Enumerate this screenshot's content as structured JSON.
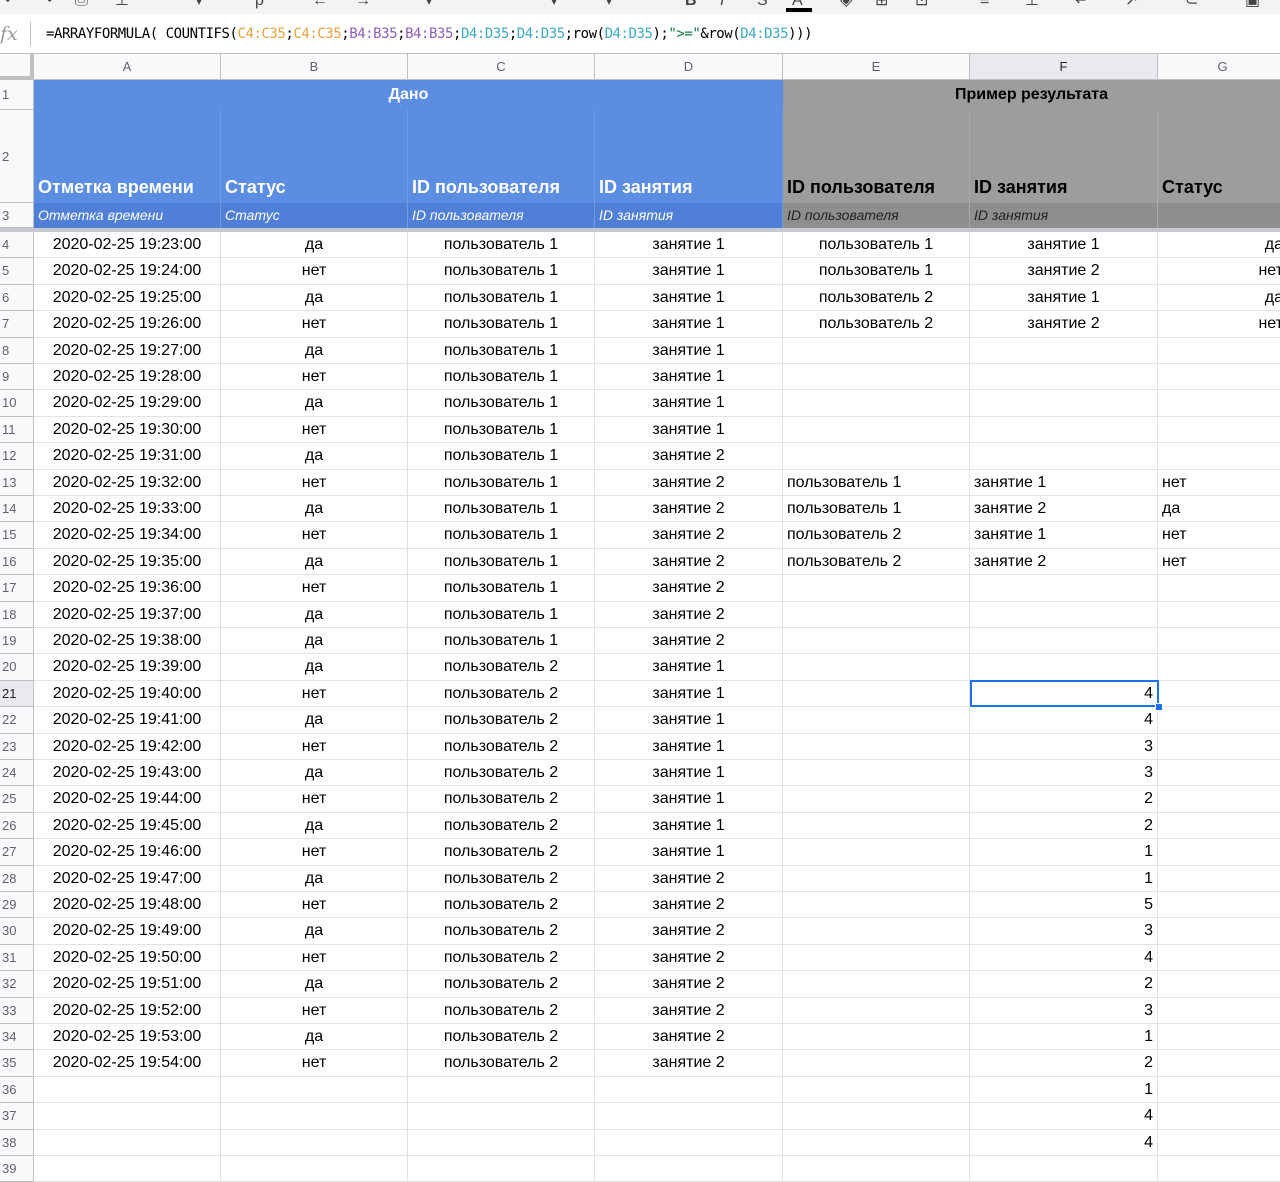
{
  "toolbar": {
    "icons": [
      "undo-icon",
      "redo-icon",
      "print-icon",
      "paint-format-icon",
      "zoom-select",
      "currency-icon",
      "decrease-decimal-icon",
      "increase-decimal-icon",
      "more-formats-icon",
      "font-select",
      "font-size-select",
      "bold-icon",
      "italic-icon",
      "strikethrough-icon",
      "text-color-icon",
      "fill-color-icon",
      "borders-icon",
      "merge-icon",
      "align-icon",
      "valign-icon",
      "wrap-icon",
      "rotate-icon",
      "link-icon",
      "comment-icon"
    ]
  },
  "formula_bar": {
    "fx": "fx",
    "segments": [
      {
        "text": "=ARRAYFORMULA( COUNTIFS(",
        "color": "#000000"
      },
      {
        "text": "C4:C35",
        "color": "#e8a23c"
      },
      {
        "text": ";",
        "color": "#000000"
      },
      {
        "text": "C4:C35",
        "color": "#e8a23c"
      },
      {
        "text": ";",
        "color": "#000000"
      },
      {
        "text": "B4:B35",
        "color": "#8e5fb5"
      },
      {
        "text": ";",
        "color": "#000000"
      },
      {
        "text": "B4:B35",
        "color": "#8e5fb5"
      },
      {
        "text": ";",
        "color": "#000000"
      },
      {
        "text": "D4:D35",
        "color": "#3fa9c0"
      },
      {
        "text": ";",
        "color": "#000000"
      },
      {
        "text": "D4:D35",
        "color": "#3fa9c0"
      },
      {
        "text": ";row(",
        "color": "#000000"
      },
      {
        "text": "D4:D35",
        "color": "#3fa9c0"
      },
      {
        "text": ");",
        "color": "#000000"
      },
      {
        "text": "\">=\"",
        "color": "#0b8043"
      },
      {
        "text": "&row(",
        "color": "#000000"
      },
      {
        "text": "D4:D35",
        "color": "#3fa9c0"
      },
      {
        "text": ")))",
        "color": "#000000"
      }
    ]
  },
  "columns": [
    "A",
    "B",
    "C",
    "D",
    "E",
    "F",
    "G"
  ],
  "selected_column": "F",
  "selected_row": "21",
  "header": {
    "band_given": "Дано",
    "band_result": "Пример результата",
    "row2": [
      "Отметка времени",
      "Статус",
      "ID пользователя",
      "ID занятия",
      "ID пользователя",
      "ID занятия",
      "Статус"
    ],
    "row3": [
      "Отметка времени",
      "Статус",
      "ID пользователя",
      "ID занятия",
      "ID пользователя",
      "ID занятия",
      ""
    ]
  },
  "colors": {
    "given": "#5b8de3",
    "result": "#9d9d9d",
    "selection": "#1a73e8"
  },
  "rows": [
    {
      "n": "4",
      "a": "2020-02-25 19:23:00",
      "b": "да",
      "c": "пользователь 1",
      "d": "занятие 1",
      "e": "пользователь 1",
      "f": "занятие 1",
      "g": "да"
    },
    {
      "n": "5",
      "a": "2020-02-25 19:24:00",
      "b": "нет",
      "c": "пользователь 1",
      "d": "занятие 1",
      "e": "пользователь 1",
      "f": "занятие 2",
      "g": "нет"
    },
    {
      "n": "6",
      "a": "2020-02-25 19:25:00",
      "b": "да",
      "c": "пользователь 1",
      "d": "занятие 1",
      "e": "пользователь 2",
      "f": "занятие 1",
      "g": "да"
    },
    {
      "n": "7",
      "a": "2020-02-25 19:26:00",
      "b": "нет",
      "c": "пользователь 1",
      "d": "занятие 1",
      "e": "пользователь 2",
      "f": "занятие 2",
      "g": "нет"
    },
    {
      "n": "8",
      "a": "2020-02-25 19:27:00",
      "b": "да",
      "c": "пользователь 1",
      "d": "занятие 1",
      "e": "",
      "f": "",
      "g": ""
    },
    {
      "n": "9",
      "a": "2020-02-25 19:28:00",
      "b": "нет",
      "c": "пользователь 1",
      "d": "занятие 1",
      "e": "",
      "f": "",
      "g": ""
    },
    {
      "n": "10",
      "a": "2020-02-25 19:29:00",
      "b": "да",
      "c": "пользователь 1",
      "d": "занятие 1",
      "e": "",
      "f": "",
      "g": ""
    },
    {
      "n": "11",
      "a": "2020-02-25 19:30:00",
      "b": "нет",
      "c": "пользователь 1",
      "d": "занятие 1",
      "e": "",
      "f": "",
      "g": ""
    },
    {
      "n": "12",
      "a": "2020-02-25 19:31:00",
      "b": "да",
      "c": "пользователь 1",
      "d": "занятие 2",
      "e": "",
      "f": "",
      "g": ""
    },
    {
      "n": "13",
      "a": "2020-02-25 19:32:00",
      "b": "нет",
      "c": "пользователь 1",
      "d": "занятие 2",
      "e": "пользователь 1",
      "f": "занятие 1",
      "g": "нет"
    },
    {
      "n": "14",
      "a": "2020-02-25 19:33:00",
      "b": "да",
      "c": "пользователь 1",
      "d": "занятие 2",
      "e": "пользователь 1",
      "f": "занятие 2",
      "g": "да"
    },
    {
      "n": "15",
      "a": "2020-02-25 19:34:00",
      "b": "нет",
      "c": "пользователь 1",
      "d": "занятие 2",
      "e": "пользователь 2",
      "f": "занятие 1",
      "g": "нет"
    },
    {
      "n": "16",
      "a": "2020-02-25 19:35:00",
      "b": "да",
      "c": "пользователь 1",
      "d": "занятие 2",
      "e": "пользователь 2",
      "f": "занятие 2",
      "g": "нет"
    },
    {
      "n": "17",
      "a": "2020-02-25 19:36:00",
      "b": "нет",
      "c": "пользователь 1",
      "d": "занятие 2",
      "e": "",
      "f": "",
      "g": ""
    },
    {
      "n": "18",
      "a": "2020-02-25 19:37:00",
      "b": "да",
      "c": "пользователь 1",
      "d": "занятие 2",
      "e": "",
      "f": "",
      "g": ""
    },
    {
      "n": "19",
      "a": "2020-02-25 19:38:00",
      "b": "да",
      "c": "пользователь 1",
      "d": "занятие 2",
      "e": "",
      "f": "",
      "g": ""
    },
    {
      "n": "20",
      "a": "2020-02-25 19:39:00",
      "b": "да",
      "c": "пользователь 2",
      "d": "занятие 1",
      "e": "",
      "f": "",
      "g": ""
    },
    {
      "n": "21",
      "a": "2020-02-25 19:40:00",
      "b": "нет",
      "c": "пользователь 2",
      "d": "занятие 1",
      "e": "",
      "f": "4",
      "g": ""
    },
    {
      "n": "22",
      "a": "2020-02-25 19:41:00",
      "b": "да",
      "c": "пользователь 2",
      "d": "занятие 1",
      "e": "",
      "f": "4",
      "g": ""
    },
    {
      "n": "23",
      "a": "2020-02-25 19:42:00",
      "b": "нет",
      "c": "пользователь 2",
      "d": "занятие 1",
      "e": "",
      "f": "3",
      "g": ""
    },
    {
      "n": "24",
      "a": "2020-02-25 19:43:00",
      "b": "да",
      "c": "пользователь 2",
      "d": "занятие 1",
      "e": "",
      "f": "3",
      "g": ""
    },
    {
      "n": "25",
      "a": "2020-02-25 19:44:00",
      "b": "нет",
      "c": "пользователь 2",
      "d": "занятие 1",
      "e": "",
      "f": "2",
      "g": ""
    },
    {
      "n": "26",
      "a": "2020-02-25 19:45:00",
      "b": "да",
      "c": "пользователь 2",
      "d": "занятие 1",
      "e": "",
      "f": "2",
      "g": ""
    },
    {
      "n": "27",
      "a": "2020-02-25 19:46:00",
      "b": "нет",
      "c": "пользователь 2",
      "d": "занятие 1",
      "e": "",
      "f": "1",
      "g": ""
    },
    {
      "n": "28",
      "a": "2020-02-25 19:47:00",
      "b": "да",
      "c": "пользователь 2",
      "d": "занятие 2",
      "e": "",
      "f": "1",
      "g": ""
    },
    {
      "n": "29",
      "a": "2020-02-25 19:48:00",
      "b": "нет",
      "c": "пользователь 2",
      "d": "занятие 2",
      "e": "",
      "f": "5",
      "g": ""
    },
    {
      "n": "30",
      "a": "2020-02-25 19:49:00",
      "b": "да",
      "c": "пользователь 2",
      "d": "занятие 2",
      "e": "",
      "f": "3",
      "g": ""
    },
    {
      "n": "31",
      "a": "2020-02-25 19:50:00",
      "b": "нет",
      "c": "пользователь 2",
      "d": "занятие 2",
      "e": "",
      "f": "4",
      "g": ""
    },
    {
      "n": "32",
      "a": "2020-02-25 19:51:00",
      "b": "да",
      "c": "пользователь 2",
      "d": "занятие 2",
      "e": "",
      "f": "2",
      "g": ""
    },
    {
      "n": "33",
      "a": "2020-02-25 19:52:00",
      "b": "нет",
      "c": "пользователь 2",
      "d": "занятие 2",
      "e": "",
      "f": "3",
      "g": ""
    },
    {
      "n": "34",
      "a": "2020-02-25 19:53:00",
      "b": "да",
      "c": "пользователь 2",
      "d": "занятие 2",
      "e": "",
      "f": "1",
      "g": ""
    },
    {
      "n": "35",
      "a": "2020-02-25 19:54:00",
      "b": "нет",
      "c": "пользователь 2",
      "d": "занятие 2",
      "e": "",
      "f": "2",
      "g": ""
    },
    {
      "n": "36",
      "a": "",
      "b": "",
      "c": "",
      "d": "",
      "e": "",
      "f": "1",
      "g": ""
    },
    {
      "n": "37",
      "a": "",
      "b": "",
      "c": "",
      "d": "",
      "e": "",
      "f": "4",
      "g": ""
    },
    {
      "n": "38",
      "a": "",
      "b": "",
      "c": "",
      "d": "",
      "e": "",
      "f": "4",
      "g": ""
    },
    {
      "n": "39",
      "a": "",
      "b": "",
      "c": "",
      "d": "",
      "e": "",
      "f": "",
      "g": ""
    }
  ]
}
